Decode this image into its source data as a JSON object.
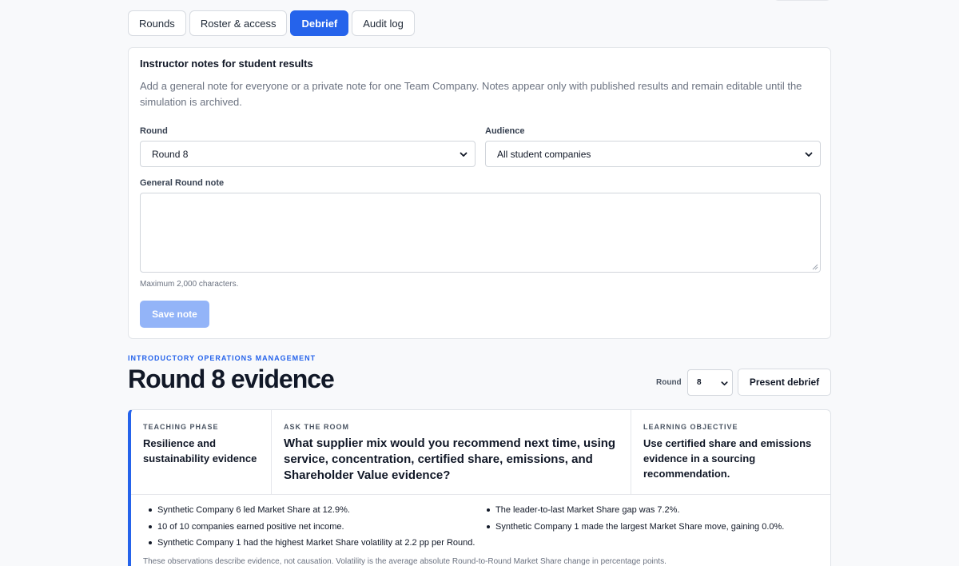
{
  "tabs": [
    {
      "label": "Rounds",
      "active": false
    },
    {
      "label": "Roster & access",
      "active": false
    },
    {
      "label": "Debrief",
      "active": true
    },
    {
      "label": "Audit log",
      "active": false
    }
  ],
  "notes_card": {
    "title": "Instructor notes for student results",
    "description": "Add a general note for everyone or a private note for one Team Company. Notes appear only with published results and remain editable until the simulation is archived.",
    "round_label": "Round",
    "round_value": "Round 8",
    "audience_label": "Audience",
    "audience_value": "All student companies",
    "note_label": "General Round note",
    "note_value": "",
    "hint": "Maximum 2,000 characters.",
    "save_label": "Save note",
    "save_enabled": false
  },
  "evidence": {
    "eyebrow": "INTRODUCTORY OPERATIONS MANAGEMENT",
    "title": "Round 8 evidence",
    "round_label": "Round",
    "round_value": "8",
    "present_label": "Present debrief",
    "accent_color": "#2563eb",
    "teaching_phase": {
      "label": "TEACHING PHASE",
      "value": "Resilience and sustainability evidence"
    },
    "ask_the_room": {
      "label": "ASK THE ROOM",
      "value": "What supplier mix would you recommend next time, using service, concentration, certified share, emissions, and Shareholder Value evidence?"
    },
    "learning_objective": {
      "label": "LEARNING OBJECTIVE",
      "value": "Use certified share and emissions evidence in a sourcing recommendation."
    },
    "observations_left": [
      "Synthetic Company 6 led Market Share at 12.9%.",
      "10 of 10 companies earned positive net income.",
      "Synthetic Company 1 had the highest Market Share volatility at 2.2 pp per Round."
    ],
    "observations_right": [
      "The leader-to-last Market Share gap was 7.2%.",
      "Synthetic Company 1 made the largest Market Share move, gaining 0.0%."
    ],
    "footnote": "These observations describe evidence, not causation. Volatility is the average absolute Round-to-Round Market Share change in percentage points."
  }
}
